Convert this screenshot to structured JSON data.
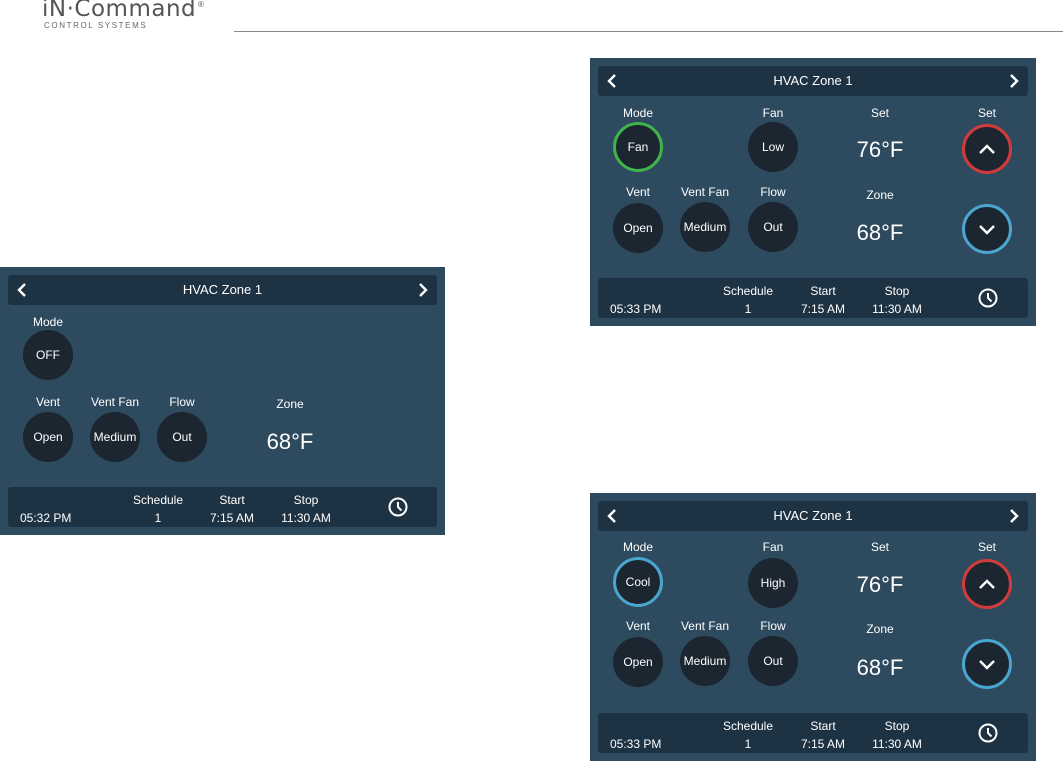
{
  "brand": {
    "name": "iN·Command",
    "reg": "®",
    "tagline": "CONTROL SYSTEMS"
  },
  "colors": {
    "panel_bg": "#2e4a5e",
    "bar_bg": "#1d3243",
    "button_bg": "#1b2631",
    "fan_ring": "#3fb34a",
    "cool_ring": "#4aa5cf",
    "up_ring": "#d23b3b",
    "down_ring": "#4aa5cf"
  },
  "panel_off": {
    "title": "HVAC Zone 1",
    "mode_label": "Mode",
    "mode_value": "OFF",
    "vent_label": "Vent",
    "vent_value": "Open",
    "vent_fan_label": "Vent Fan",
    "vent_fan_value": "Medium",
    "flow_label": "Flow",
    "flow_value": "Out",
    "zone_label": "Zone",
    "zone_temp": "68°F",
    "time": "05:32 PM",
    "schedule_label": "Schedule",
    "schedule_value": "1",
    "start_label": "Start",
    "start_value": "7:15 AM",
    "stop_label": "Stop",
    "stop_value": "11:30 AM"
  },
  "panel_fan": {
    "title": "HVAC Zone 1",
    "mode_label": "Mode",
    "mode_value": "Fan",
    "fan_label": "Fan",
    "fan_value": "Low",
    "set_label": "Set",
    "set_temp": "76°F",
    "set_arrows_label": "Set",
    "vent_label": "Vent",
    "vent_value": "Open",
    "vent_fan_label": "Vent Fan",
    "vent_fan_value": "Medium",
    "flow_label": "Flow",
    "flow_value": "Out",
    "zone_label": "Zone",
    "zone_temp": "68°F",
    "time": "05:33 PM",
    "schedule_label": "Schedule",
    "schedule_value": "1",
    "start_label": "Start",
    "start_value": "7:15 AM",
    "stop_label": "Stop",
    "stop_value": "11:30 AM"
  },
  "panel_cool": {
    "title": "HVAC Zone 1",
    "mode_label": "Mode",
    "mode_value": "Cool",
    "fan_label": "Fan",
    "fan_value": "High",
    "set_label": "Set",
    "set_temp": "76°F",
    "set_arrows_label": "Set",
    "vent_label": "Vent",
    "vent_value": "Open",
    "vent_fan_label": "Vent Fan",
    "vent_fan_value": "Medium",
    "flow_label": "Flow",
    "flow_value": "Out",
    "zone_label": "Zone",
    "zone_temp": "68°F",
    "time": "05:33 PM",
    "schedule_label": "Schedule",
    "schedule_value": "1",
    "start_label": "Start",
    "start_value": "7:15 AM",
    "stop_label": "Stop",
    "stop_value": "11:30 AM"
  }
}
